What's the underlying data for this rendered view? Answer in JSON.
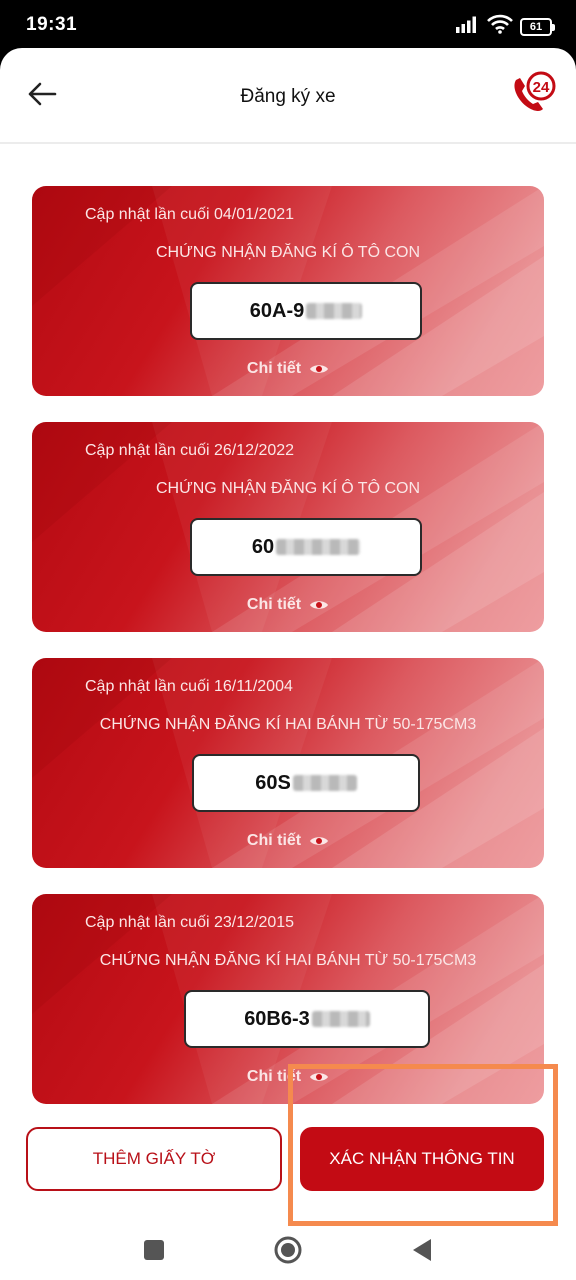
{
  "status_bar": {
    "time": "19:31",
    "battery": "61",
    "battery_icon": "battery-icon",
    "signal_icon": "signal-icon",
    "wifi_icon": "wifi-icon"
  },
  "header": {
    "title": "Đăng ký xe",
    "back_icon": "arrow-left-icon",
    "hotline_icon": "phone-24-icon",
    "hotline_number": "24"
  },
  "cards": [
    {
      "updated": "Cập nhật lần cuối 04/01/2021",
      "type": "CHỨNG NHẬN ĐĂNG KÍ Ô TÔ CON",
      "plate": "60A-9",
      "detail": "Chi tiết",
      "detail_icon": "eye-icon"
    },
    {
      "updated": "Cập nhật lần cuối 26/12/2022",
      "type": "CHỨNG NHẬN ĐĂNG KÍ Ô TÔ CON",
      "plate": "60",
      "detail": "Chi tiết",
      "detail_icon": "eye-icon"
    },
    {
      "updated": "Cập nhật lần cuối 16/11/2004",
      "type": "CHỨNG NHẬN ĐĂNG KÍ HAI BÁNH TỪ 50-175CM3",
      "plate": "60S",
      "detail": "Chi tiết",
      "detail_icon": "eye-icon"
    },
    {
      "updated": "Cập nhật lần cuối 23/12/2015",
      "type": "CHỨNG NHẬN ĐĂNG KÍ HAI BÁNH TỪ 50-175CM3",
      "plate": "60B6-3",
      "detail": "Chi tiết",
      "detail_icon": "eye-icon"
    }
  ],
  "actions": {
    "add_label": "THÊM GIẤY TỜ",
    "confirm_label": "XÁC NHẬN THÔNG TIN"
  },
  "nav": {
    "recents_icon": "square-icon",
    "home_icon": "circle-icon",
    "back_icon": "triangle-back-icon"
  },
  "colors": {
    "primary": "#c30b14",
    "highlight": "#f58a4e"
  }
}
